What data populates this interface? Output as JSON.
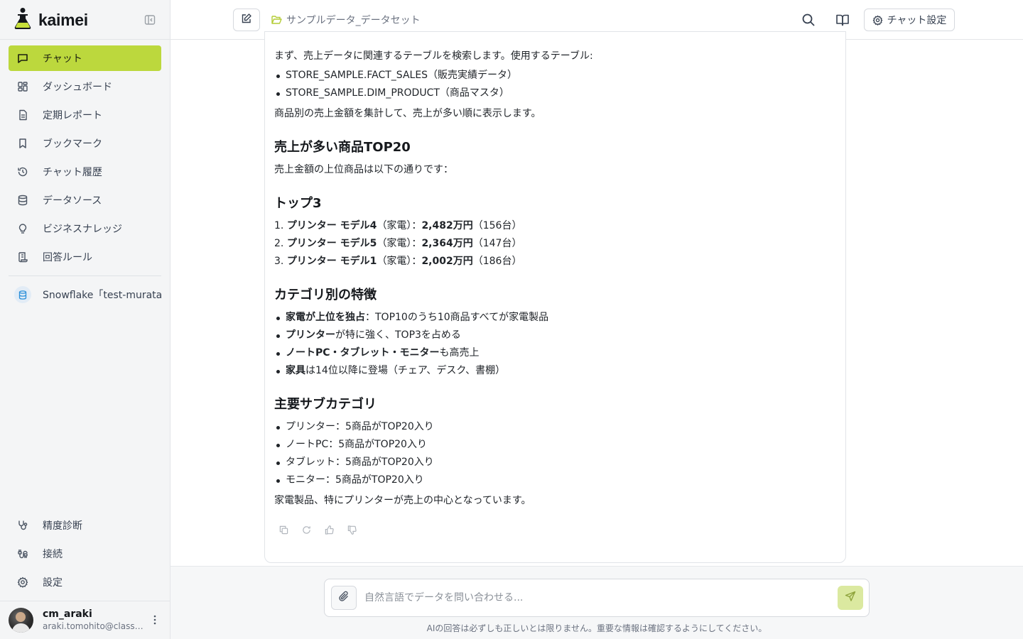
{
  "app": {
    "brand": "kaimei",
    "accent_color": "#bcd83d"
  },
  "sidebar": {
    "items": [
      {
        "label": "チャット",
        "icon": "chat-icon",
        "active": true
      },
      {
        "label": "ダッシュボード",
        "icon": "dashboard-icon"
      },
      {
        "label": "定期レポート",
        "icon": "report-icon"
      },
      {
        "label": "ブックマーク",
        "icon": "bookmark-icon"
      },
      {
        "label": "チャット履歴",
        "icon": "history-icon"
      },
      {
        "label": "データソース",
        "icon": "database-icon"
      },
      {
        "label": "ビジネスナレッジ",
        "icon": "lightbulb-icon"
      },
      {
        "label": "回答ルール",
        "icon": "rules-icon"
      }
    ],
    "datasource": {
      "label": "Snowflake「test-murata」",
      "icon": "snowflake-database-icon"
    },
    "bottom_items": [
      {
        "label": "精度診断",
        "icon": "stethoscope-icon"
      },
      {
        "label": "接続",
        "icon": "cable-icon"
      },
      {
        "label": "設定",
        "icon": "gear-icon"
      }
    ],
    "user": {
      "name": "cm_araki",
      "email": "araki.tomohito@classmethod.jp"
    }
  },
  "topbar": {
    "dataset": "サンプルデータ_データセット",
    "settings_label": "チャット設定"
  },
  "message": {
    "intro": "まず、売上データに関連するテーブルを検索します。使用するテーブル:",
    "tables": [
      "STORE_SAMPLE.FACT_SALES（販売実績データ）",
      "STORE_SAMPLE.DIM_PRODUCT（商品マスタ）"
    ],
    "summary": "商品別の売上金額を集計して、売上が多い順に表示します。",
    "h1": "売上が多い商品TOP20",
    "h1_text": "売上金額の上位商品は以下の通りです：",
    "h2": "トップ3",
    "top3": [
      {
        "num": "1.",
        "name": "プリンター モデル4",
        "cat": "（家電）：",
        "amount": "2,482万円",
        "units": "（156台）"
      },
      {
        "num": "2.",
        "name": "プリンター モデル5",
        "cat": "（家電）：",
        "amount": "2,364万円",
        "units": "（147台）"
      },
      {
        "num": "3.",
        "name": "プリンター モデル1",
        "cat": "（家電）：",
        "amount": "2,002万円",
        "units": "（186台）"
      }
    ],
    "h3": "カテゴリ別の特徴",
    "features": [
      {
        "bold": "家電が上位を独占",
        "rest": "：TOP10のうち10商品すべてが家電製品"
      },
      {
        "bold": "プリンター",
        "rest": "が特に強く、TOP3を占める"
      },
      {
        "bold": "ノートPC・タブレット・モニター",
        "rest": "も高売上"
      },
      {
        "bold": "家具",
        "rest": "は14位以降に登場（チェア、デスク、書棚）"
      }
    ],
    "h4": "主要サブカテゴリ",
    "subcategories": [
      "プリンター：5商品がTOP20入り",
      "ノートPC：5商品がTOP20入り",
      "タブレット：5商品がTOP20入り",
      "モニター：5商品がTOP20入り"
    ],
    "conclusion": "家電製品、特にプリンターが売上の中心となっています。"
  },
  "input": {
    "placeholder": "自然言語でデータを問い合わせる...",
    "value": ""
  },
  "disclaimer": "AIの回答は必ずしも正しいとは限りません。重要な情報は確認するようにしてください。"
}
